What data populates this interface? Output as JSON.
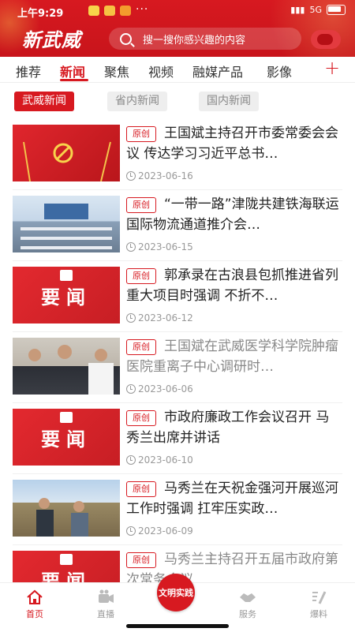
{
  "status_bar": {
    "time": "上午9:29",
    "network": "5G"
  },
  "header": {
    "logo": "新武威",
    "search_placeholder": "搜一搜你感兴趣的内容"
  },
  "tabs": [
    {
      "label": "推荐"
    },
    {
      "label": "新闻",
      "active": true
    },
    {
      "label": "聚焦"
    },
    {
      "label": "视频"
    },
    {
      "label": "融媒产品"
    },
    {
      "label": "影像"
    }
  ],
  "add_tab_label": "+",
  "subtabs": [
    {
      "label": "武威新闻",
      "active": true
    },
    {
      "label": "省内新闻"
    },
    {
      "label": "国内新闻"
    }
  ],
  "news": [
    {
      "badge": "原创",
      "title": "王国斌主持召开市委常委会会议 传达学习习近平总书…",
      "date": "2023-06-16",
      "thumb": "party-flag",
      "dim": false
    },
    {
      "badge": "原创",
      "title": "“一带一路”津陇共建铁海联运国际物流通道推介会…",
      "date": "2023-06-15",
      "thumb": "meeting-hall",
      "dim": false
    },
    {
      "badge": "原创",
      "title": "郭承录在古浪县包抓推进省列重大项目时强调 不折不…",
      "date": "2023-06-12",
      "thumb": "yaowen",
      "thumb_text": "要闻",
      "dim": false
    },
    {
      "badge": "原创",
      "title": "王国斌在武威医学科学院肿瘤医院重离子中心调研时…",
      "date": "2023-06-06",
      "thumb": "people",
      "dim": true
    },
    {
      "badge": "原创",
      "title": "市政府廉政工作会议召开 马秀兰出席并讲话",
      "date": "2023-06-10",
      "thumb": "yaowen",
      "thumb_text": "要闻",
      "dim": false
    },
    {
      "badge": "原创",
      "title": "马秀兰在天祝金强河开展巡河工作时强调 扛牢压实政…",
      "date": "2023-06-09",
      "thumb": "field",
      "dim": false
    },
    {
      "badge": "原创",
      "title": "马秀兰主持召开五届市政府第 次常务会议",
      "date": "",
      "thumb": "yaowen",
      "thumb_text": "要闻",
      "dim": true
    }
  ],
  "bottom_nav": {
    "home": "首页",
    "live": "直播",
    "center": "文明实践",
    "service": "服务",
    "report": "爆料"
  },
  "colors": {
    "brand_red": "#d71920",
    "muted": "#999999"
  }
}
